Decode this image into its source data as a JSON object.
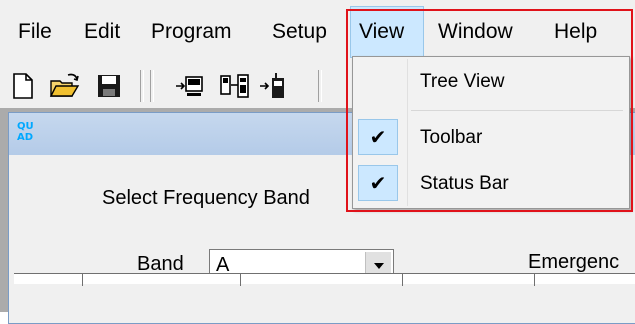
{
  "menubar": {
    "items": [
      {
        "label": "File"
      },
      {
        "label": "Edit"
      },
      {
        "label": "Program"
      },
      {
        "label": "Setup"
      },
      {
        "label": "View"
      },
      {
        "label": "Window"
      },
      {
        "label": "Help"
      }
    ],
    "active": "View"
  },
  "toolbar": {
    "buttons": [
      {
        "icon": "new-document-icon"
      },
      {
        "icon": "open-folder-icon"
      },
      {
        "icon": "save-icon"
      },
      {
        "icon": "read-from-radio-icon"
      },
      {
        "icon": "write-to-radio-icon"
      },
      {
        "icon": "radio-handset-icon"
      }
    ]
  },
  "child_window": {
    "app_icon_text_line1": "QU",
    "app_icon_text_line2": "AD",
    "select_band_label": "Select Frequency Band",
    "band_label": "Band",
    "band_value": "A",
    "emergency_label": "Emergenc"
  },
  "view_menu": {
    "items": [
      {
        "label": "Tree View",
        "checked": false
      },
      {
        "label": "Toolbar",
        "checked": true
      },
      {
        "label": "Status Bar",
        "checked": true
      }
    ],
    "check_glyph": "✔"
  },
  "colors": {
    "menu_highlight": "#cce8ff",
    "annotation_red": "#e0121a",
    "app_icon": "#00a8ff"
  }
}
